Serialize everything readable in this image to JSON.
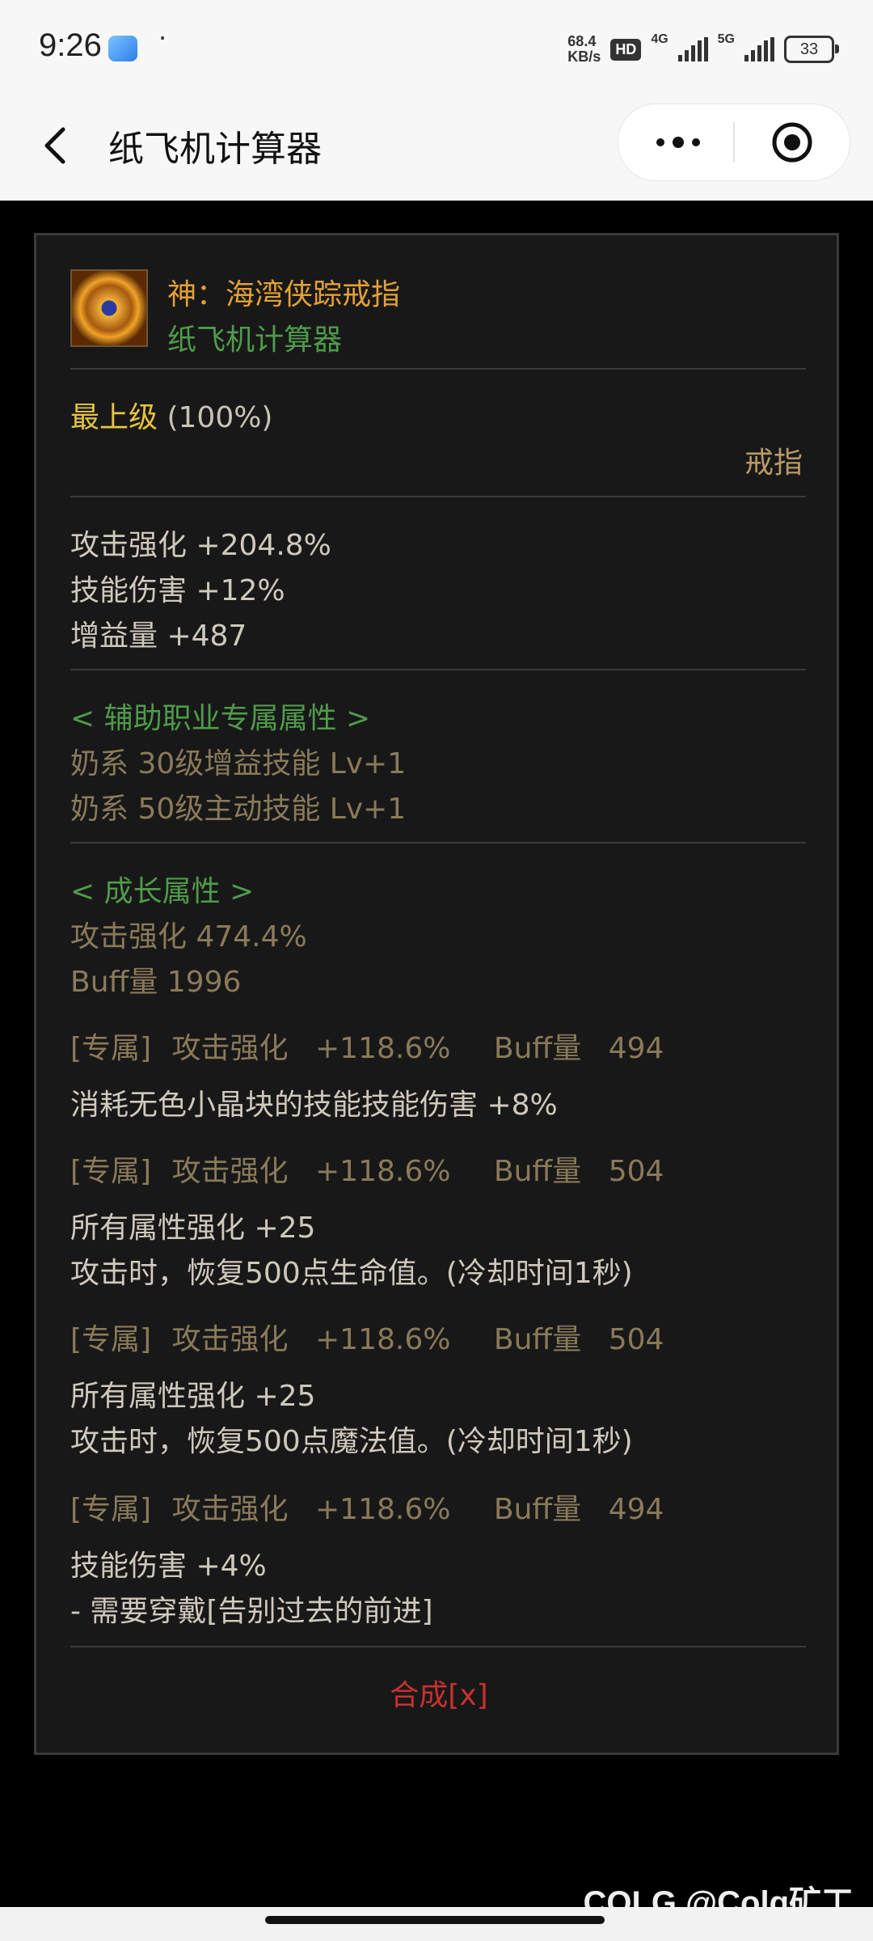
{
  "status_bar": {
    "time": "9:26",
    "dot": "·",
    "speed_value": "68.4",
    "speed_unit": "KB/s",
    "hd_badge": "HD",
    "net1": "4G",
    "net2": "5G",
    "battery": "33"
  },
  "nav": {
    "title": "纸飞机计算器",
    "back_icon": "chevron-left-icon",
    "more_icon": "more-dots-icon",
    "target_icon": "target-icon"
  },
  "item": {
    "name": "神：海湾侠踪戒指",
    "source": "纸飞机计算器",
    "grade_label": "最上级",
    "grade_pct": "(100%)",
    "slot": "戒指",
    "base_stats": [
      "攻击强化 +204.8%",
      "技能伤害 +12%",
      "增益量 +487"
    ],
    "support_header": "< 辅助职业专属属性 >",
    "support_stats": [
      "奶系 30级增益技能 Lv+1",
      "奶系 50级主动技能 Lv+1"
    ],
    "growth_header": "< 成长属性 >",
    "growth_stats": [
      "攻击强化 474.4%",
      "Buff量 1996"
    ],
    "exclusive": [
      {
        "tag": "[专属]",
        "atk_label": "攻击强化",
        "atk": "+118.6%",
        "buff_label": "Buff量",
        "buff": "494",
        "effects": [
          "消耗无色小晶块的技能技能伤害 +8%"
        ]
      },
      {
        "tag": "[专属]",
        "atk_label": "攻击强化",
        "atk": "+118.6%",
        "buff_label": "Buff量",
        "buff": "504",
        "effects": [
          "所有属性强化 +25",
          "攻击时，恢复500点生命值。(冷却时间1秒)"
        ]
      },
      {
        "tag": "[专属]",
        "atk_label": "攻击强化",
        "atk": "+118.6%",
        "buff_label": "Buff量",
        "buff": "504",
        "effects": [
          "所有属性强化 +25",
          "攻击时，恢复500点魔法值。(冷却时间1秒)"
        ]
      },
      {
        "tag": "[专属]",
        "atk_label": "攻击强化",
        "atk": "+118.6%",
        "buff_label": "Buff量",
        "buff": "494",
        "effects": [
          "技能伤害 +4%",
          "- 需要穿戴[告别过去的前进]"
        ]
      }
    ],
    "synthesis": "合成[x]"
  },
  "watermark": "COLG @Colg矿工"
}
